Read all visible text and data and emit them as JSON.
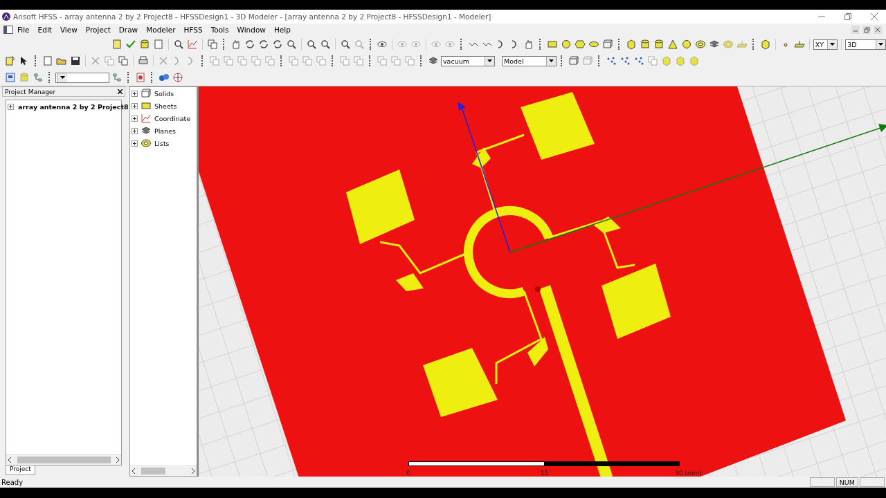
{
  "window": {
    "title": "Ansoft HFSS  - array antenna 2 by 2 Project8 - HFSSDesign1 - 3D Modeler - [array antenna 2 by 2 Project8 - HFSSDesign1 - Modeler]"
  },
  "menu": [
    "File",
    "Edit",
    "View",
    "Project",
    "Draw",
    "Modeler",
    "HFSS",
    "Tools",
    "Window",
    "Help"
  ],
  "toolbar": {
    "plane": "XY",
    "view": "3D",
    "material": "vacuum",
    "mode": "Model"
  },
  "project_manager": {
    "title": "Project Manager",
    "project": "array antenna 2 by 2 Project8",
    "tab": "Project"
  },
  "model_tree": {
    "items": [
      "Solids",
      "Sheets",
      "Coordinate",
      "Planes",
      "Lists"
    ]
  },
  "scale_bar": {
    "labels": [
      "0",
      "15",
      "30 (mm)"
    ]
  },
  "status_bar": {
    "message": "Ready",
    "indicators": [
      "NUM"
    ]
  }
}
